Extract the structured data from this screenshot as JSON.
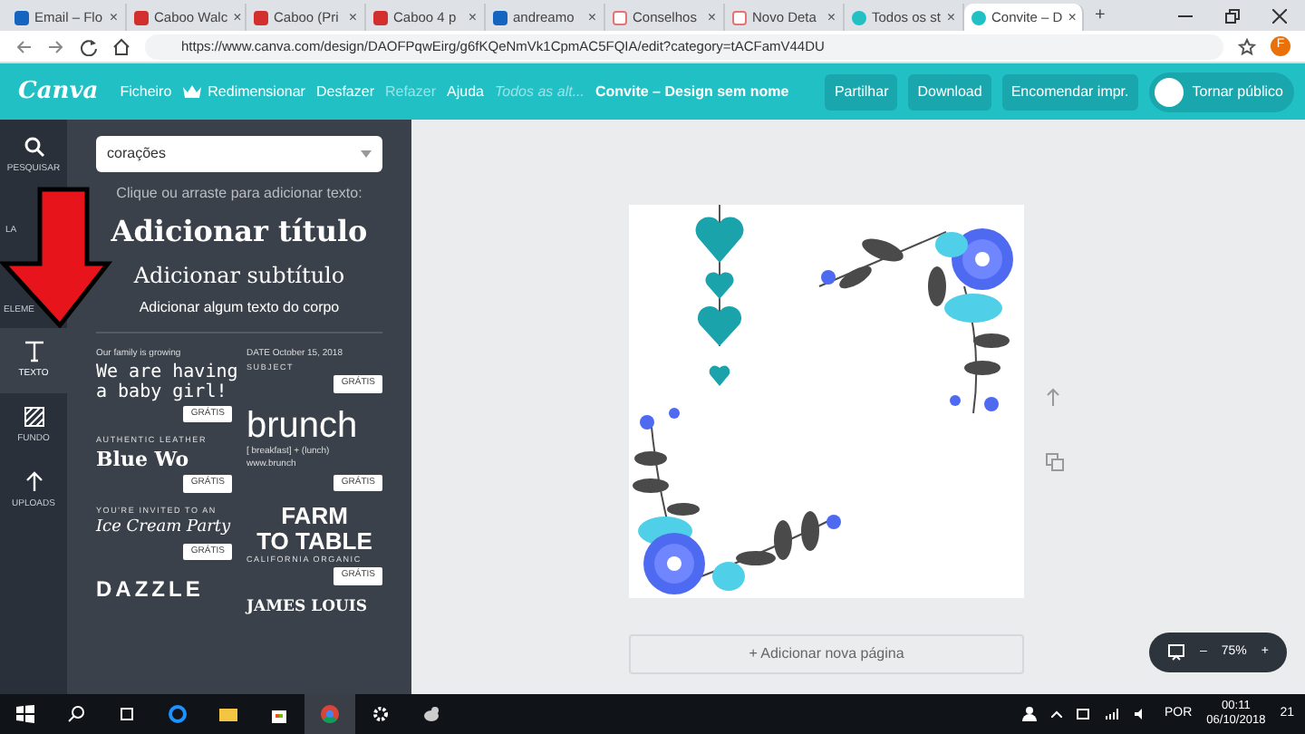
{
  "browser": {
    "tabs": [
      {
        "title": "Email – Flo",
        "kind": "mail",
        "close": "×",
        "selected": false
      },
      {
        "title": "Caboo Walc",
        "kind": "red",
        "close": "×",
        "selected": false
      },
      {
        "title": "Caboo (Pri",
        "kind": "red",
        "close": "×",
        "selected": false
      },
      {
        "title": "Caboo 4 p",
        "kind": "red",
        "close": "×",
        "selected": false
      },
      {
        "title": "andreamo",
        "kind": "mail",
        "close": "×",
        "selected": false
      },
      {
        "title": "Conselhos",
        "kind": "heart",
        "close": "×",
        "selected": false
      },
      {
        "title": "Novo Deta",
        "kind": "heart",
        "close": "×",
        "selected": false
      },
      {
        "title": "Todos os st",
        "kind": "canva",
        "close": "×",
        "selected": false
      },
      {
        "title": "Convite – D",
        "kind": "canva",
        "close": "×",
        "selected": true
      }
    ],
    "new_tab": "+",
    "url": "https://www.canva.com/design/DAOFPqwEirg/g6fKQeNmVk1CpmAC5FQIA/edit?category=tACFamV44DU",
    "profile": "F"
  },
  "toolbar": {
    "logo": "Canva",
    "menu": [
      {
        "label": "Ficheiro",
        "kind": "plain",
        "disabled": false
      },
      {
        "label": "Redimensionar",
        "kind": "crown",
        "disabled": false
      },
      {
        "label": "Desfazer",
        "kind": "plain",
        "disabled": false
      },
      {
        "label": "Refazer",
        "kind": "plain",
        "disabled": true
      },
      {
        "label": "Ajuda",
        "kind": "plain",
        "disabled": false
      }
    ],
    "hint": "Todos as alt...",
    "document_title": "Convite – Design sem nome",
    "buttons": [
      "Partilhar",
      "Download",
      "Encomendar impr."
    ],
    "publish": "Tornar público"
  },
  "rail": [
    {
      "label": "PESQUISAR",
      "kind": "search",
      "selected": false
    },
    {
      "label": "LA",
      "kind": "layouts",
      "selected": false
    },
    {
      "label": "ELEME",
      "kind": "elements",
      "selected": false
    },
    {
      "label": "TEXTO",
      "kind": "text",
      "selected": true
    },
    {
      "label": "FUNDO",
      "kind": "background",
      "selected": false
    },
    {
      "label": "UPLOADS",
      "kind": "uploads",
      "selected": false
    }
  ],
  "panel": {
    "search": {
      "value": "corações"
    },
    "hint": "Clique ou arraste para adicionar texto:",
    "title": "Adicionar título",
    "subtitle": "Adicionar subtítulo",
    "body": "Adicionar algum texto do corpo",
    "columns": [
      [
        {
          "lines": [
            {
              "text": "Our family is growing",
              "kind": "small"
            },
            {
              "text": "We are having",
              "kind": "hand"
            },
            {
              "text": "a baby girl!",
              "kind": "hand"
            }
          ],
          "badge": "GRÁTIS"
        },
        {
          "lines": [
            {
              "text": "AUTHENTIC LEATHER",
              "kind": "caps"
            },
            {
              "text": "Blue Wo",
              "kind": "serif"
            }
          ],
          "badge": "GRÁTIS"
        },
        {
          "lines": [
            {
              "text": "YOU'RE INVITED TO AN",
              "kind": "caps"
            },
            {
              "text": "Ice Cream Party",
              "kind": "script"
            }
          ],
          "badge": "GRÁTIS"
        },
        {
          "lines": [
            {
              "text": "DAZZLE",
              "kind": "wide"
            }
          ]
        }
      ],
      [
        {
          "lines": [
            {
              "text": "DATE   October 15, 2018",
              "kind": "small"
            },
            {
              "text": "SUBJECT",
              "kind": "caps"
            }
          ],
          "badge": "GRÁTIS"
        },
        {
          "lines": [
            {
              "text": "brunch",
              "kind": "big"
            },
            {
              "text": "[ breakfast] + (lunch)",
              "kind": "small"
            },
            {
              "text": "www.brunch",
              "kind": "small"
            }
          ],
          "badge": "GRÁTIS"
        },
        {
          "lines": [
            {
              "text": "FARM",
              "kind": "bold"
            },
            {
              "text": "TO TABLE",
              "kind": "bold"
            },
            {
              "text": "CALIFORNIA ORGANIC",
              "kind": "caps"
            }
          ],
          "badge": "GRÁTIS"
        },
        {
          "lines": [
            {
              "text": "JAMES LOUIS",
              "kind": "serif"
            }
          ]
        }
      ]
    ]
  },
  "canvas": {
    "add_page": "+ Adicionar nova página",
    "zoom": "75%",
    "zoom_out": "–",
    "zoom_in": "+"
  },
  "taskbar": {
    "language": "POR",
    "time": "00:11",
    "date": "06/10/2018",
    "notifications": "21"
  }
}
